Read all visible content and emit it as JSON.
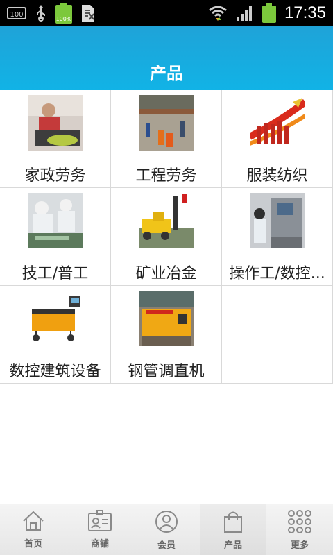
{
  "status_bar": {
    "time": "17:35",
    "battery_label": "100%",
    "left_badge": "100"
  },
  "header": {
    "title": "产品"
  },
  "categories": [
    {
      "label": "家政劳务"
    },
    {
      "label": "工程劳务"
    },
    {
      "label": "服装纺织"
    },
    {
      "label": "技工/普工"
    },
    {
      "label": "矿业冶金"
    },
    {
      "label": "操作工/数控..."
    },
    {
      "label": "数控建筑设备"
    },
    {
      "label": "钢管调直机"
    }
  ],
  "tabbar": {
    "tabs": [
      {
        "label": "首页",
        "icon": "home-icon"
      },
      {
        "label": "商铺",
        "icon": "shop-card-icon"
      },
      {
        "label": "会员",
        "icon": "user-icon"
      },
      {
        "label": "产品",
        "icon": "bag-icon"
      },
      {
        "label": "更多",
        "icon": "more-grid-icon"
      }
    ],
    "active": "产品"
  },
  "colors": {
    "header": "#11b3e6",
    "statusbar": "#000000",
    "battery": "#7cc83c"
  }
}
